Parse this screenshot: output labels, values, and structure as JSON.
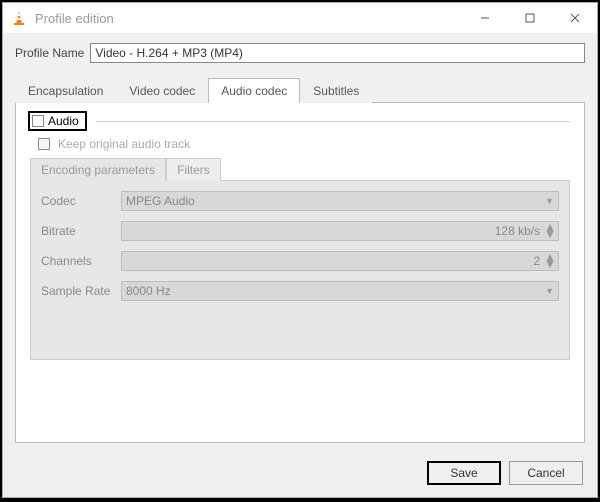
{
  "window": {
    "title": "Profile edition"
  },
  "profile": {
    "label": "Profile Name",
    "value": "Video - H.264 + MP3 (MP4)"
  },
  "tabs": {
    "encapsulation": "Encapsulation",
    "video_codec": "Video codec",
    "audio_codec": "Audio codec",
    "subtitles": "Subtitles"
  },
  "audio": {
    "checkbox_label": "Audio",
    "keep_original": "Keep original audio track",
    "subtabs": {
      "encoding": "Encoding parameters",
      "filters": "Filters"
    },
    "fields": {
      "codec_label": "Codec",
      "codec_value": "MPEG Audio",
      "bitrate_label": "Bitrate",
      "bitrate_value": "128 kb/s",
      "channels_label": "Channels",
      "channels_value": "2",
      "samplerate_label": "Sample Rate",
      "samplerate_value": "8000 Hz"
    }
  },
  "buttons": {
    "save": "Save",
    "cancel": "Cancel"
  }
}
